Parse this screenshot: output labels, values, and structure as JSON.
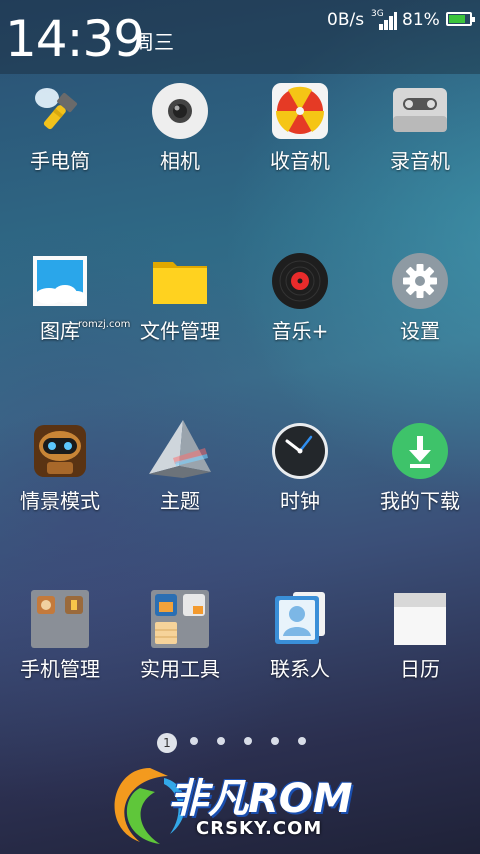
{
  "status_bar": {
    "time": "14:39",
    "weekday": "周三",
    "net_speed": "0B/s",
    "signal_type": "3G",
    "battery": "81%",
    "battery_level": 0.81,
    "battery_color": "#3cc43c"
  },
  "apps": [
    {
      "label": "手电筒",
      "icon": "flashlight-icon"
    },
    {
      "label": "相机",
      "icon": "camera-icon"
    },
    {
      "label": "收音机",
      "icon": "radio-icon"
    },
    {
      "label": "录音机",
      "icon": "recorder-icon"
    },
    {
      "label": "图库",
      "icon": "gallery-icon"
    },
    {
      "label": "文件管理",
      "icon": "folder-icon"
    },
    {
      "label": "音乐+",
      "icon": "music-record-icon"
    },
    {
      "label": "设置",
      "icon": "gear-icon"
    },
    {
      "label": "情景模式",
      "icon": "robot-icon"
    },
    {
      "label": "主题",
      "icon": "prism-icon"
    },
    {
      "label": "时钟",
      "icon": "clock-icon"
    },
    {
      "label": "我的下载",
      "icon": "download-icon"
    },
    {
      "label": "手机管理",
      "icon": "phone-manager-folder-icon"
    },
    {
      "label": "实用工具",
      "icon": "tools-folder-icon"
    },
    {
      "label": "联系人",
      "icon": "contacts-icon"
    },
    {
      "label": "日历",
      "icon": "calendar-icon"
    }
  ],
  "pager": {
    "current": "1",
    "total": 6
  },
  "watermarks": {
    "romzj": "romzj.com",
    "brand": "非凡ROM",
    "site": "CRSKY.COM"
  }
}
